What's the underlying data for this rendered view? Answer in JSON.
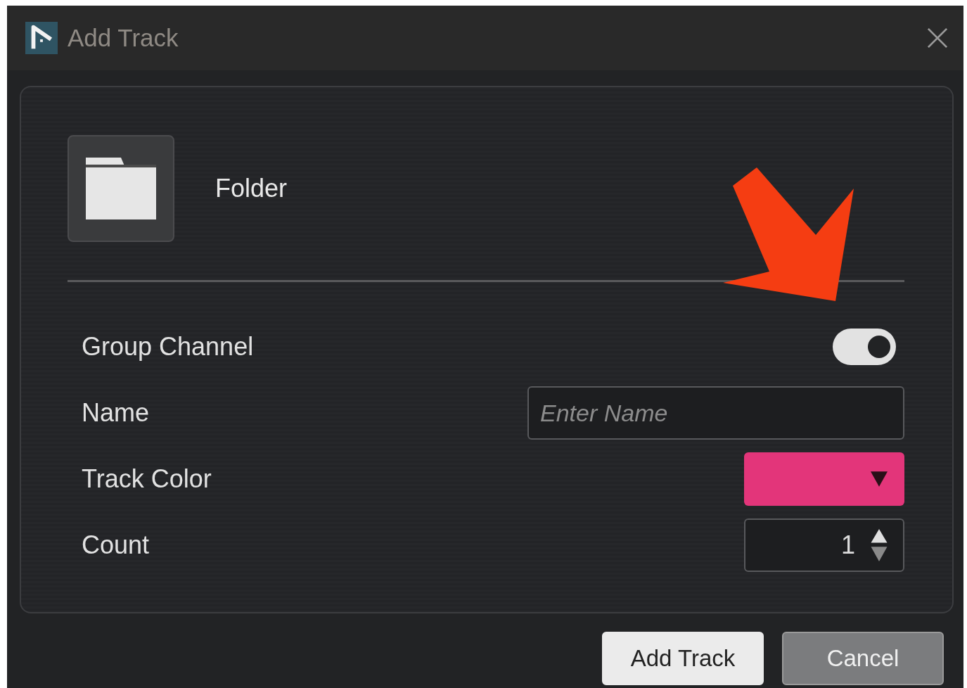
{
  "window": {
    "title": "Add Track"
  },
  "track_type": {
    "label": "Folder"
  },
  "fields": [
    {
      "kind": "toggle",
      "label": "Group Channel",
      "on": true
    },
    {
      "kind": "text",
      "label": "Name",
      "placeholder": "Enter Name"
    },
    {
      "kind": "color",
      "label": "Track Color",
      "color": "#e3357a"
    },
    {
      "kind": "number",
      "label": "Count",
      "value": "1"
    }
  ],
  "buttons": [
    {
      "label": "Add Track",
      "primary": true
    },
    {
      "label": "Cancel",
      "primary": false
    }
  ]
}
